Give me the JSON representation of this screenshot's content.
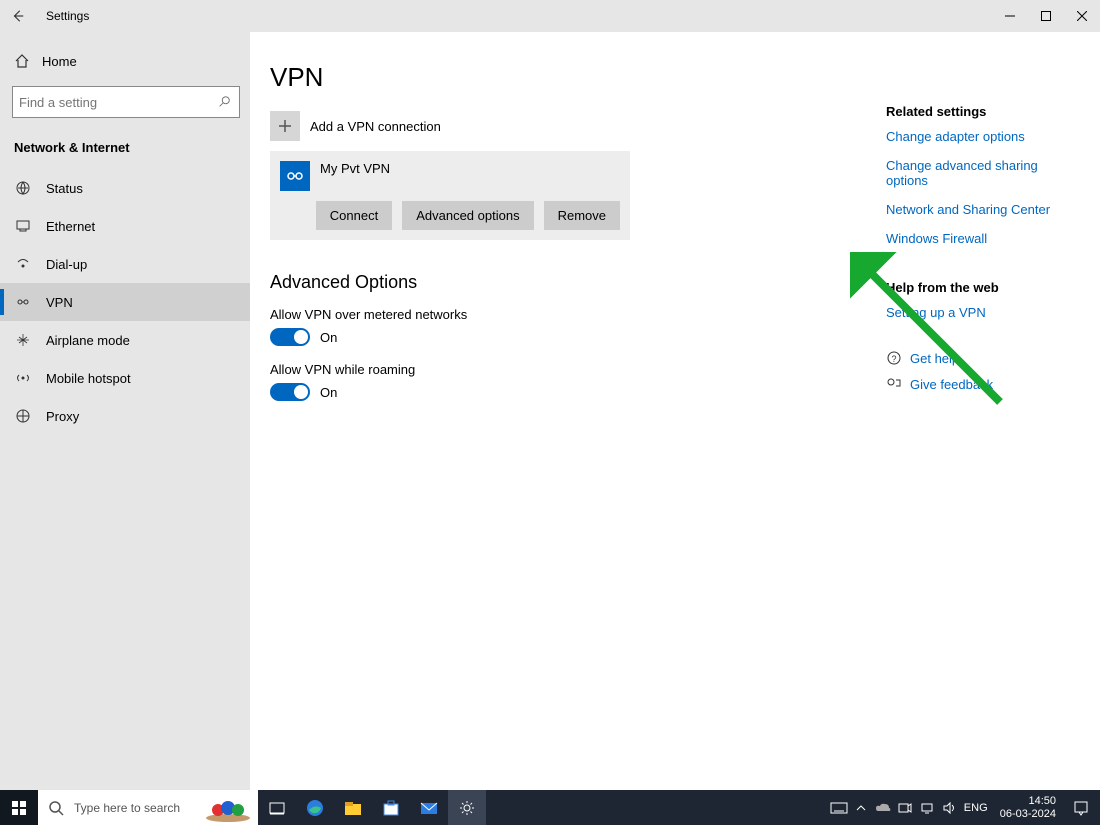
{
  "titlebar": {
    "title": "Settings"
  },
  "sidebar": {
    "home": "Home",
    "search_placeholder": "Find a setting",
    "category": "Network & Internet",
    "items": [
      {
        "label": "Status"
      },
      {
        "label": "Ethernet"
      },
      {
        "label": "Dial-up"
      },
      {
        "label": "VPN"
      },
      {
        "label": "Airplane mode"
      },
      {
        "label": "Mobile hotspot"
      },
      {
        "label": "Proxy"
      }
    ]
  },
  "page": {
    "title": "VPN",
    "add_label": "Add a VPN connection",
    "vpn": {
      "name": "My Pvt VPN",
      "connect": "Connect",
      "advanced": "Advanced options",
      "remove": "Remove"
    },
    "adv_title": "Advanced Options",
    "toggle1_label": "Allow VPN over metered networks",
    "toggle1_state": "On",
    "toggle2_label": "Allow VPN while roaming",
    "toggle2_state": "On"
  },
  "rightcol": {
    "related_head": "Related settings",
    "links": [
      "Change adapter options",
      "Change advanced sharing options",
      "Network and Sharing Center",
      "Windows Firewall"
    ],
    "help_head": "Help from the web",
    "help_link": "Setting up a VPN",
    "get_help": "Get help",
    "feedback": "Give feedback"
  },
  "taskbar": {
    "search_placeholder": "Type here to search",
    "lang": "ENG",
    "time": "14:50",
    "date": "06-03-2024"
  }
}
